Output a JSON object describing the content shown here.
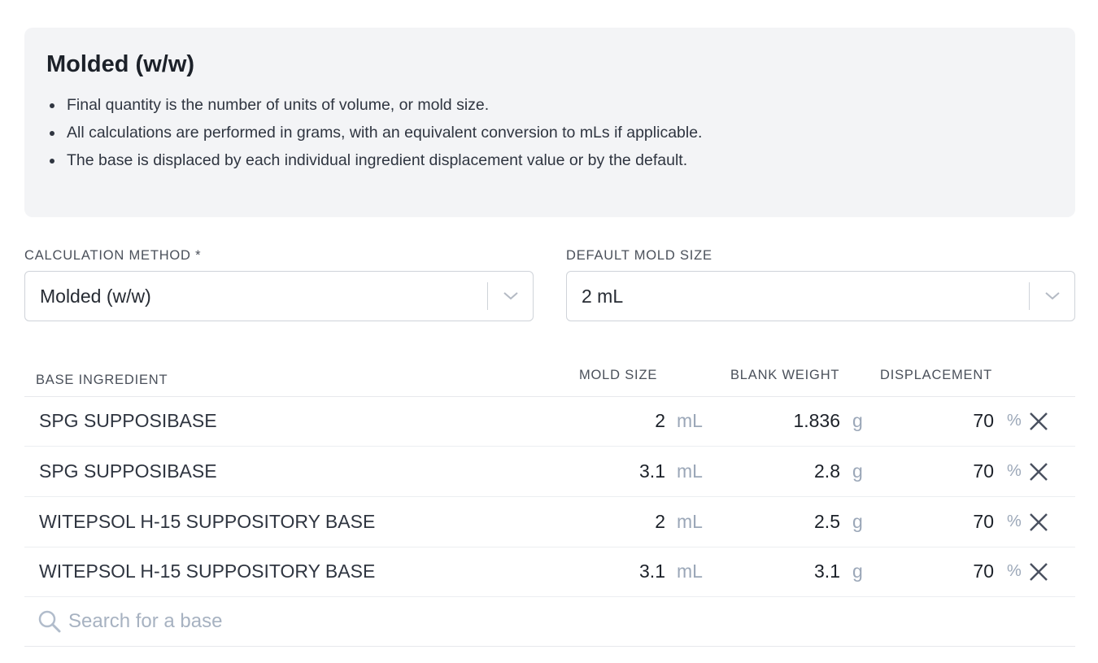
{
  "info": {
    "title": "Molded (w/w)",
    "bullets": [
      "Final quantity is the number of units of volume, or mold size.",
      "All calculations are performed in grams, with an equivalent conversion to mLs if applicable.",
      "The base is displaced by each individual ingredient displacement value or by the default."
    ]
  },
  "calculation_method": {
    "label": "CALCULATION METHOD *",
    "value": "Molded (w/w)"
  },
  "default_mold_size": {
    "label": "DEFAULT MOLD SIZE",
    "value": "2 mL"
  },
  "table": {
    "headers": {
      "base_ingredient": "BASE INGREDIENT",
      "mold_size": "MOLD SIZE",
      "blank_weight": "BLANK WEIGHT",
      "displacement": "DISPLACEMENT"
    },
    "rows": [
      {
        "name": "SPG SUPPOSIBASE",
        "mold_size": "2",
        "mold_unit": "mL",
        "blank_weight": "1.836",
        "weight_unit": "g",
        "displacement": "70",
        "disp_unit": "%"
      },
      {
        "name": "SPG SUPPOSIBASE",
        "mold_size": "3.1",
        "mold_unit": "mL",
        "blank_weight": "2.8",
        "weight_unit": "g",
        "displacement": "70",
        "disp_unit": "%"
      },
      {
        "name": "WITEPSOL H-15 SUPPOSITORY BASE",
        "mold_size": "2",
        "mold_unit": "mL",
        "blank_weight": "2.5",
        "weight_unit": "g",
        "displacement": "70",
        "disp_unit": "%"
      },
      {
        "name": "WITEPSOL H-15 SUPPOSITORY BASE",
        "mold_size": "3.1",
        "mold_unit": "mL",
        "blank_weight": "3.1",
        "weight_unit": "g",
        "displacement": "70",
        "disp_unit": "%"
      }
    ]
  },
  "search": {
    "placeholder": "Search for a base",
    "value": ""
  },
  "icons": {
    "dropdown": "chevron-down-icon",
    "remove": "close-icon",
    "search": "search-icon"
  },
  "colors": {
    "panel_bg": "#f3f4f6",
    "unit_text": "#9ba7b8",
    "placeholder": "#a7b2c1"
  }
}
